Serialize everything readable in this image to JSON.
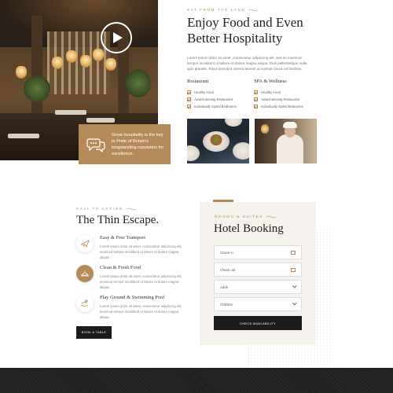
{
  "hero": {
    "eyebrow": "EAT FROM THE LAND",
    "title_line1": "Enjoy Food and Even",
    "title_line2": "Better Hospitality",
    "paragraph": "Lorem ipsum dolor sit amet, consectetur adipiscing elit, sed do eiusmod tempor incididunt ut labore et dolore magna aliqua. Duis pellentesque nulla quis grandis. Risus tincidunt viverra laoreet accumsan lacus vel facilisis.",
    "quote": "Great hospitality is the key to Pride of Britain's longstanding reputation for excellence."
  },
  "features": {
    "restaurant": {
      "heading": "Restaurant",
      "items": [
        "Healthy Food",
        "Award-winning Restaurant",
        "Individually Styled Bedrooms"
      ]
    },
    "spa": {
      "heading": "SPA & Wellness",
      "items": [
        "Healthy Food",
        "Award-winning Restaurant",
        "Individually Styled Bedrooms"
      ]
    }
  },
  "escape": {
    "eyebrow": "CALL TO ACTION",
    "title": "The Thin Escape.",
    "items": [
      {
        "title": "Easy & Free Transport",
        "text": "Lorem ipsum dolor sit amet, consectetur adipiscing elit, eiusmod tempor incididunt ut labore et dolore magna aliqua."
      },
      {
        "title": "Clean & Fresh Food",
        "text": "Lorem ipsum dolor sit amet, consectetur adipiscing elit, eiusmod tempor incididunt ut labore et dolore magna aliqua."
      },
      {
        "title": "Play Ground & Swimming Pool",
        "text": "Lorem ipsum dolor sit amet, consectetur adipiscing elit, eiusmod tempor incididunt ut labore et dolore magna aliqua."
      }
    ],
    "button": "BOOK A TABLE"
  },
  "booking": {
    "eyebrow": "ROOMS & SUITES",
    "title": "Hotel Booking",
    "check_in": "Check in",
    "check_out": "Check out",
    "adult": "Adult",
    "children": "Children",
    "button": "CHECK AVAILABILITY"
  },
  "colors": {
    "accent": "#b38a58",
    "dark": "#1c1c1c",
    "panel": "#f5f1ec"
  }
}
